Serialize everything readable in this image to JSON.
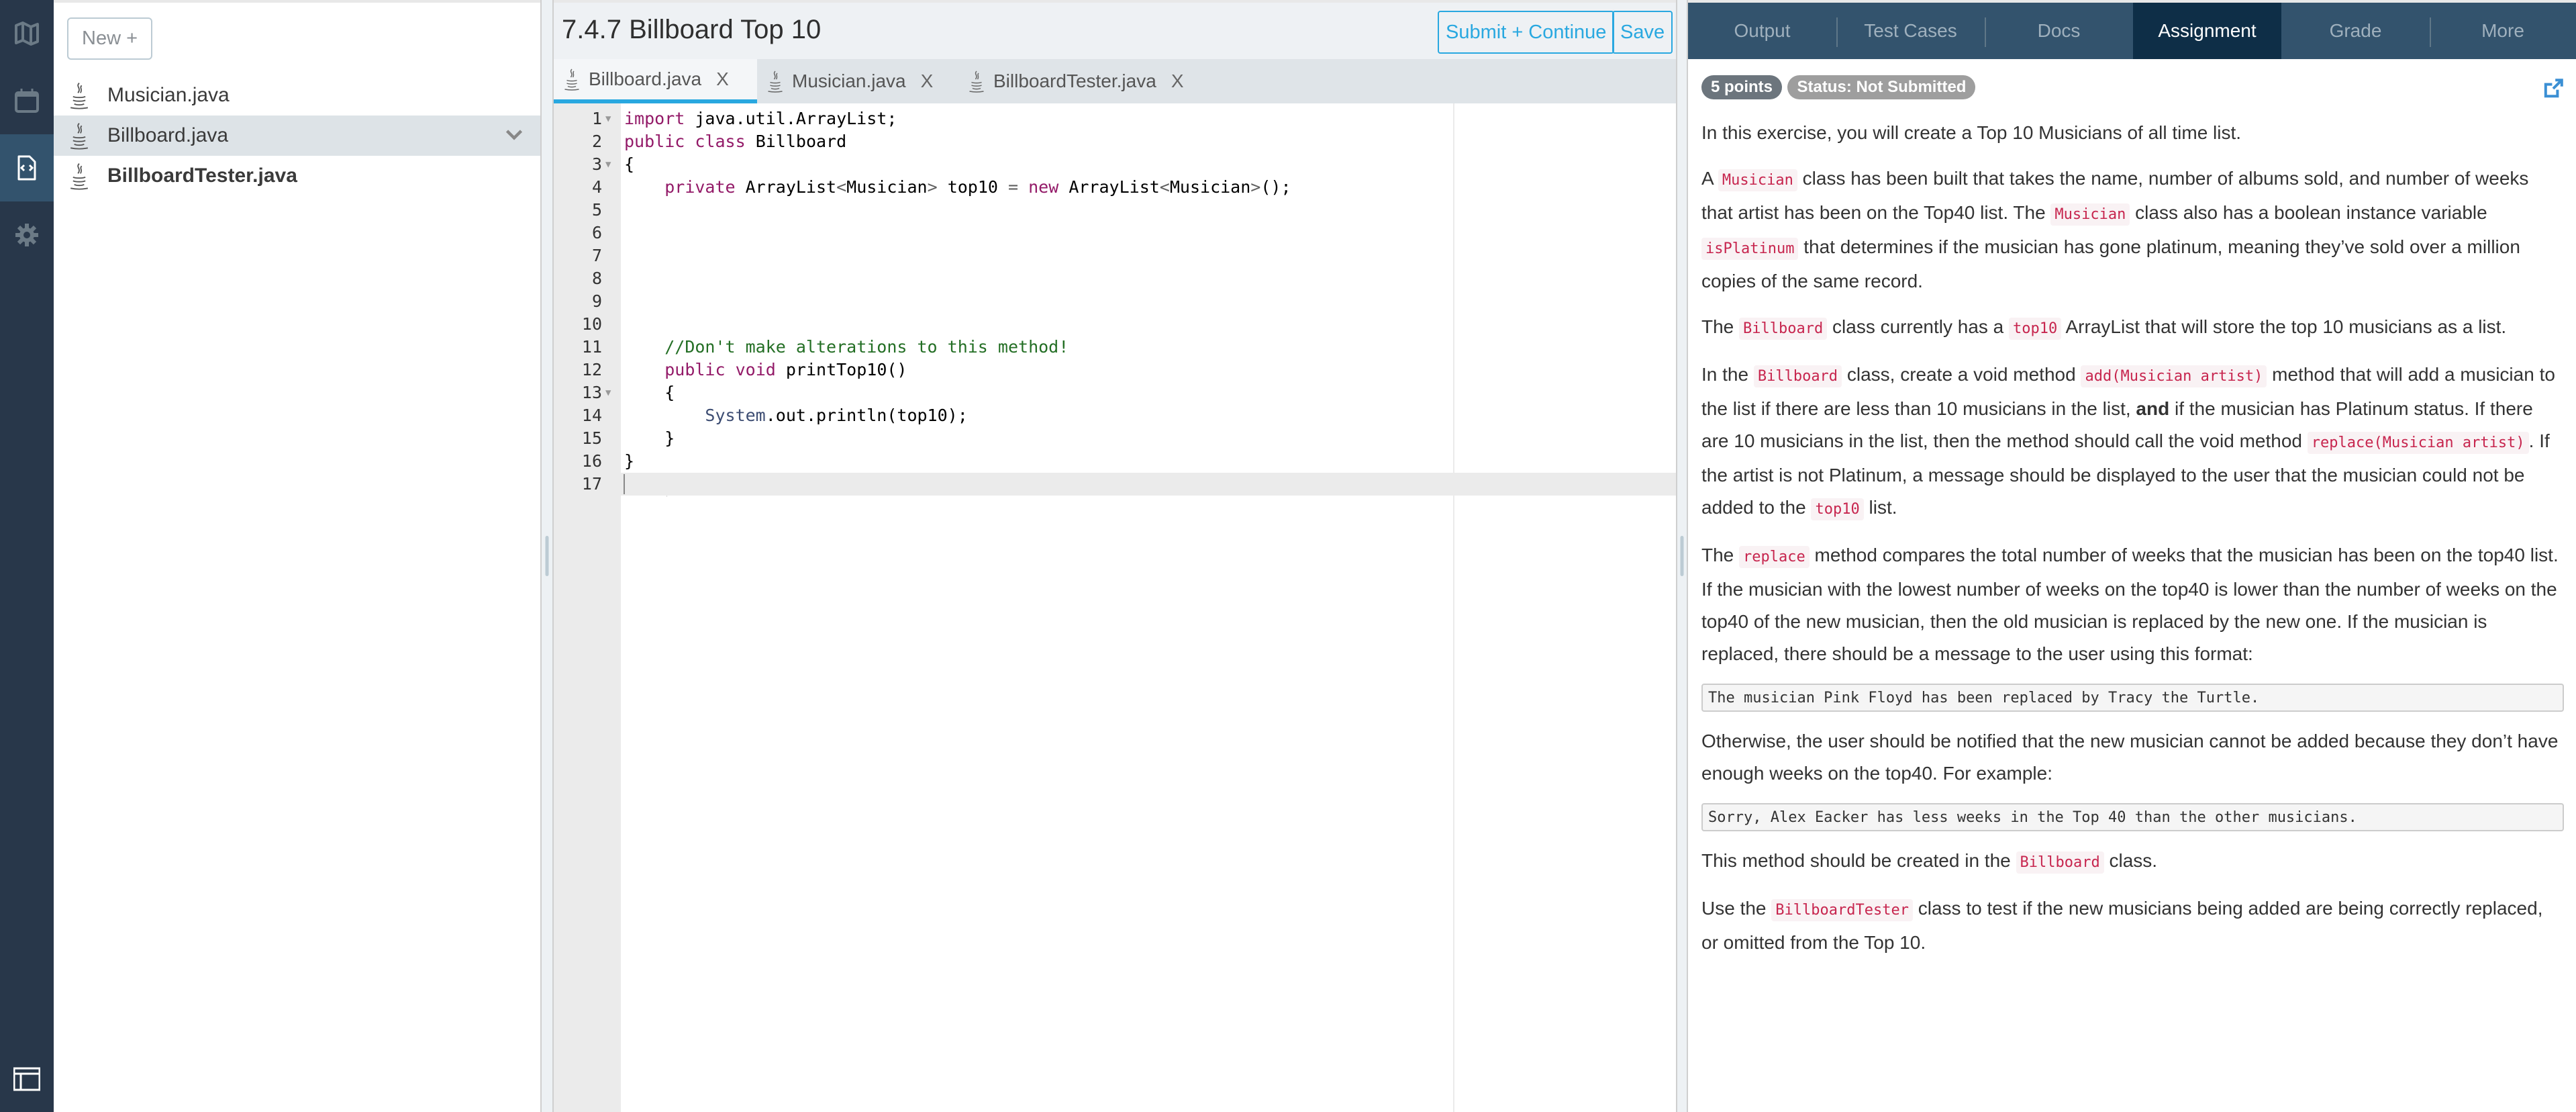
{
  "rail": {
    "items": [
      {
        "name": "map",
        "icon": "map-icon",
        "active": false
      },
      {
        "name": "calendar",
        "icon": "calendar-icon",
        "active": false
      },
      {
        "name": "code",
        "icon": "code-file-icon",
        "active": true
      },
      {
        "name": "settings",
        "icon": "gear-icon",
        "active": false
      }
    ],
    "bottom_icon": "layout-icon"
  },
  "files": {
    "new_label": "New +",
    "items": [
      {
        "name": "Musician.java",
        "selected": false,
        "bold": false
      },
      {
        "name": "Billboard.java",
        "selected": true,
        "bold": false
      },
      {
        "name": "BillboardTester.java",
        "selected": false,
        "bold": true
      }
    ]
  },
  "header": {
    "title": "7.4.7 Billboard Top 10",
    "submit_label": "Submit + Continue",
    "save_label": "Save"
  },
  "tabs": [
    {
      "label": "Billboard.java",
      "close": "X",
      "active": true
    },
    {
      "label": "Musician.java",
      "close": "X",
      "active": false
    },
    {
      "label": "BillboardTester.java",
      "close": "X",
      "active": false
    }
  ],
  "code": {
    "current_line": 17,
    "lines": [
      {
        "n": "1",
        "fold": true,
        "text": "import java.util.ArrayList;"
      },
      {
        "n": "2",
        "fold": false,
        "text": "public class Billboard"
      },
      {
        "n": "3",
        "fold": true,
        "text": "{"
      },
      {
        "n": "4",
        "fold": false,
        "text": "    private ArrayList<Musician> top10 = new ArrayList<Musician>();"
      },
      {
        "n": "5",
        "fold": false,
        "text": ""
      },
      {
        "n": "6",
        "fold": false,
        "text": ""
      },
      {
        "n": "7",
        "fold": false,
        "text": ""
      },
      {
        "n": "8",
        "fold": false,
        "text": ""
      },
      {
        "n": "9",
        "fold": false,
        "text": ""
      },
      {
        "n": "10",
        "fold": false,
        "text": ""
      },
      {
        "n": "11",
        "fold": false,
        "text": "    //Don't make alterations to this method!"
      },
      {
        "n": "12",
        "fold": false,
        "text": "    public void printTop10()"
      },
      {
        "n": "13",
        "fold": true,
        "text": "    {"
      },
      {
        "n": "14",
        "fold": false,
        "text": "        System.out.println(top10);"
      },
      {
        "n": "15",
        "fold": false,
        "text": "    }"
      },
      {
        "n": "16",
        "fold": false,
        "text": "}"
      },
      {
        "n": "17",
        "fold": false,
        "text": ""
      }
    ]
  },
  "right_tabs": [
    {
      "label": "Output",
      "active": false
    },
    {
      "label": "Test Cases",
      "active": false
    },
    {
      "label": "Docs",
      "active": false
    },
    {
      "label": "Assignment",
      "active": true
    },
    {
      "label": "Grade",
      "active": false
    },
    {
      "label": "More",
      "active": false
    }
  ],
  "assignment": {
    "points_badge": "5 points",
    "status_badge": "Status: Not Submitted",
    "paragraphs": [
      [
        {
          "t": "In this exercise, you will create a Top 10 Musicians of all time list."
        }
      ],
      [
        {
          "t": "A "
        },
        {
          "c": "Musician"
        },
        {
          "t": " class has been built that takes the name, number of albums sold, and number of weeks that artist has been on the Top40 list. The "
        },
        {
          "c": "Musician"
        },
        {
          "t": " class also has a boolean instance variable "
        },
        {
          "c": "isPlatinum"
        },
        {
          "t": " that determines if the musician has gone platinum, meaning they’ve sold over a million copies of the same record."
        }
      ],
      [
        {
          "t": "The "
        },
        {
          "c": "Billboard"
        },
        {
          "t": " class currently has a "
        },
        {
          "c": "top10"
        },
        {
          "t": " ArrayList that will store the top 10 musicians as a list."
        }
      ],
      [
        {
          "t": "In the "
        },
        {
          "c": "Billboard"
        },
        {
          "t": " class, create a void method "
        },
        {
          "c": "add(Musician artist)"
        },
        {
          "t": " method that will add a musician to the list if there are less than 10 musicians in the list, "
        },
        {
          "b": "and"
        },
        {
          "t": " if the musician has Platinum status. If there are 10 musicians in the list, then the method should call the void method "
        },
        {
          "c": "replace(Musician artist)"
        },
        {
          "t": ". If the artist is not Platinum, a message should be displayed to the user that the musician could not be added to the "
        },
        {
          "c": "top10"
        },
        {
          "t": " list."
        }
      ],
      [
        {
          "t": "The "
        },
        {
          "c": "replace"
        },
        {
          "t": " method compares the total number of weeks that the musician has been on the top40 list. If the musician with the lowest number of weeks on the top40 is lower than the number of weeks on the top40 of the new musician, then the old musician is replaced by the new one. If the musician is replaced, there should be a message to the user using this format:"
        }
      ],
      {
        "pre": "The musician Pink Floyd has been replaced by Tracy the Turtle."
      },
      [
        {
          "t": "Otherwise, the user should be notified that the new musician cannot be added because they don’t have enough weeks on the top40. For example:"
        }
      ],
      {
        "pre": "Sorry, Alex Eacker has less weeks in the Top 40 than the other musicians."
      },
      [
        {
          "t": "This method should be created in the "
        },
        {
          "c": "Billboard"
        },
        {
          "t": " class."
        }
      ],
      [
        {
          "t": "Use the "
        },
        {
          "c": "BillboardTester"
        },
        {
          "t": " class to test if the new musicians being added are being correctly replaced, or omitted from the Top 10."
        }
      ]
    ]
  },
  "colors": {
    "rail_bg": "#28374a",
    "rail_active": "#33536d",
    "accent": "#29a8e0",
    "right_tab_bg": "#33536d",
    "right_tab_active": "#0e2e47",
    "inline_code": "#c7254e",
    "keyword": "#931a68",
    "comment": "#236e24"
  }
}
